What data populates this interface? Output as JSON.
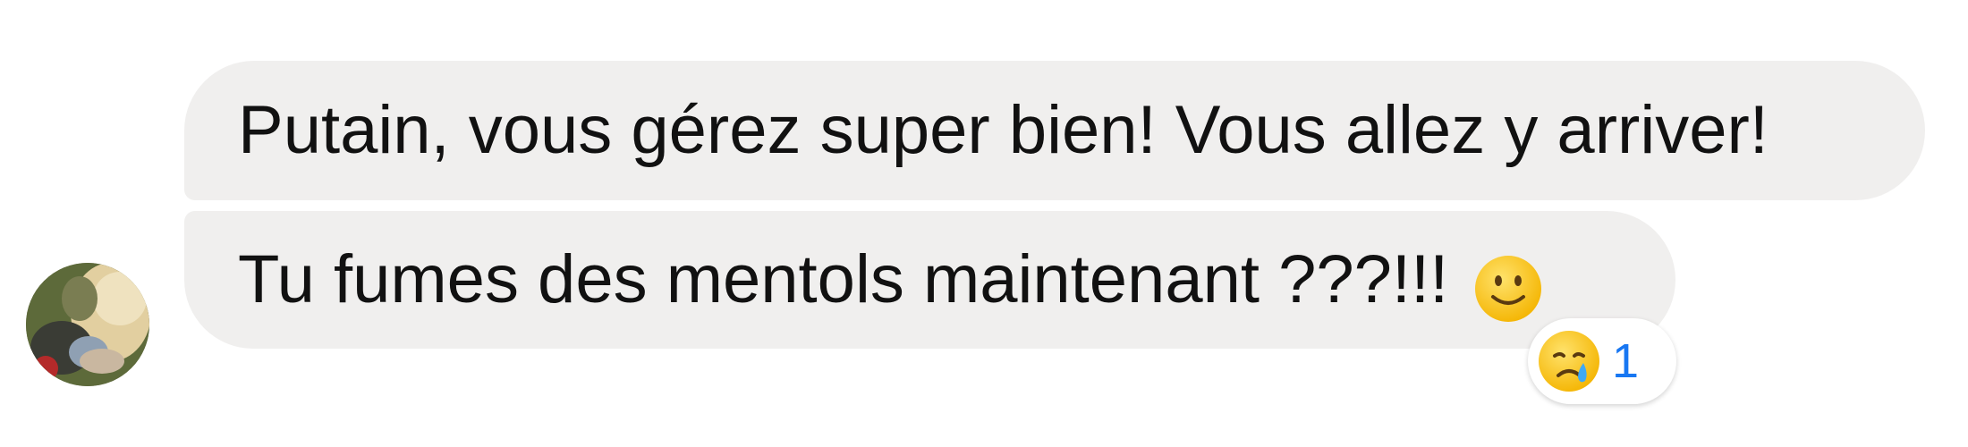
{
  "messages": [
    {
      "text": "Putain, vous gérez super bien! Vous allez y arriver!"
    },
    {
      "text": "Tu fumes des mentols maintenant ???!!!",
      "trailing_emoji": "slightly-smiling-face"
    }
  ],
  "reaction": {
    "emoji": "crying-face",
    "count": "1"
  },
  "colors": {
    "bubble_background": "#f0efee",
    "text": "#111111",
    "reaction_count": "#1877f2",
    "emoji_yellow": "#f7c52a",
    "tear_blue": "#3fa9f5"
  }
}
